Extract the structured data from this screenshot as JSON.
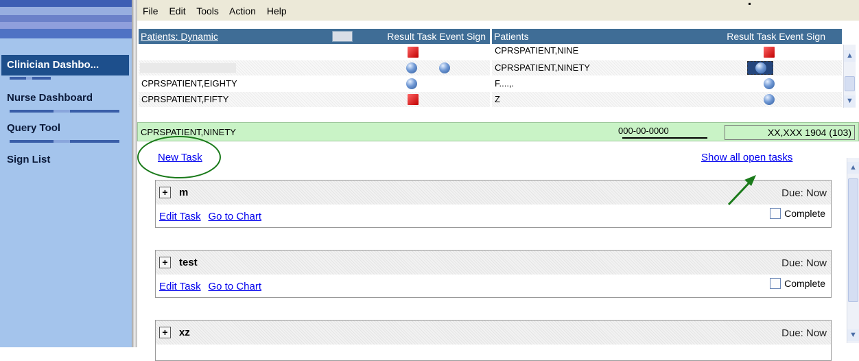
{
  "sidebar": {
    "items": [
      {
        "label": "Clinician Dashbo...",
        "active": true
      },
      {
        "label": "Nurse Dashboard",
        "active": false
      },
      {
        "label": "Query Tool",
        "active": false
      },
      {
        "label": "Sign List",
        "active": false
      }
    ]
  },
  "menu": [
    "File",
    "Edit",
    "Tools",
    "Action",
    "Help"
  ],
  "left_list": {
    "title": "Patients: Dynamic",
    "columns": "Result Task Event Sign",
    "rows": [
      {
        "name": "",
        "icons": [
          "task-red"
        ]
      },
      {
        "name": "",
        "icons": [
          "task-blue",
          "event-blue"
        ]
      },
      {
        "name": "CPRSPATIENT,EIGHTY",
        "icons": [
          "task-blue"
        ]
      },
      {
        "name": "CPRSPATIENT,FIFTY",
        "icons": [
          "task-red"
        ]
      }
    ]
  },
  "right_list": {
    "title": "Patients",
    "columns": "Result Task Event Sign",
    "rows": [
      {
        "name": "CPRSPATIENT,NINE",
        "icons": [
          "task-red"
        ]
      },
      {
        "name": "CPRSPATIENT,NINETY",
        "icons": [
          "task-blue-focused"
        ]
      },
      {
        "name": "F....,. ",
        "icons": [
          "task-blue"
        ]
      },
      {
        "name": "Z",
        "icons": [
          "task-blue"
        ]
      }
    ]
  },
  "patient_bar": {
    "name": "CPRSPATIENT,NINETY",
    "ssn": "000-00-0000",
    "dob": "XX,XXX 1904 (103)"
  },
  "tasks": {
    "new_task": "New Task",
    "show_all": "Show all open tasks",
    "items": [
      {
        "title": "m",
        "due": "Due: Now",
        "edit": "Edit Task",
        "chart": "Go to Chart",
        "complete": "Complete"
      },
      {
        "title": "test",
        "due": "Due: Now",
        "edit": "Edit Task",
        "chart": "Go to Chart",
        "complete": "Complete"
      },
      {
        "title": "xz",
        "due": "Due: Now",
        "edit": "",
        "chart": "",
        "complete": ""
      }
    ]
  },
  "colors": {
    "sidebar_bg": "#a4c4ec",
    "sidebar_active": "#1d4f8c",
    "list_header": "#3f6d96",
    "patient_bar": "#c9f3c6",
    "annotation": "#1a7a1a",
    "link": "#0000ee"
  }
}
